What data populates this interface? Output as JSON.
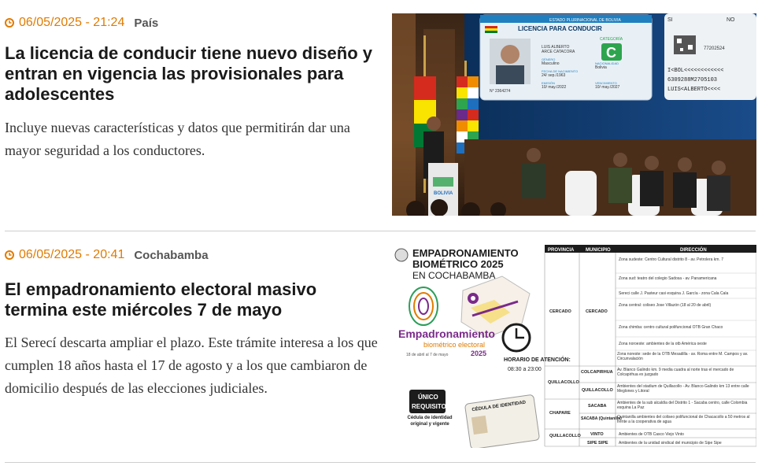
{
  "articles": [
    {
      "date": "06/05/2025 - 21:24",
      "section": "País",
      "title": "La licencia de conducir tiene nuevo diseño y entran en vigencia las provisionales para adolescentes",
      "summary": "Incluye nuevas características y datos que permitirán dar una mayor seguridad a los conductores.",
      "image": {
        "card_header": "ESTADO PLURINACIONAL DE BOLIVIA",
        "card_title": "LICENCIA PARA CONDUCIR",
        "card_category_label": "CATEGORÍA",
        "card_category": "C",
        "card_name": "LUIS ALBERTO",
        "card_surname": "ARCE CATACORA",
        "card_gender_label": "GÉNERO",
        "card_gender": "Masculino",
        "card_nationality_label": "NACIONALIDAD",
        "card_nationality": "Bolivia",
        "card_birth_label": "FECHA DE NACIMIENTO",
        "card_birth": "24/ sep./1963",
        "card_issue_label": "EMISIÓN",
        "card_issue": "10/ may./2022",
        "card_expiry_label": "VENCIMIENTO",
        "card_expiry": "10/ may./2027",
        "card_number": "N° 2364274",
        "back_si": "SI",
        "back_no": "NO",
        "back_mrz1": "I<BOL<<<<<<<<<<<<",
        "back_mrz2": "6309288M2705103",
        "back_mrz3": "LUIS<ALBERTO<<<<",
        "back_code": "77202524",
        "podium_label": "BOLIVIA"
      }
    },
    {
      "date": "06/05/2025 - 20:41",
      "section": "Cochabamba",
      "title": "El empadronamiento electoral masivo termina este miércoles 7 de mayo",
      "summary": "El Serecí descarta ampliar el plazo. Este trámite interesa a los que cumplen 18 años hasta el 17 de agosto y a los que cambiaron de domicilio después de las elecciones judiciales.",
      "image": {
        "heading1": "EMPADRONAMIENTO",
        "heading2": "BIOMÉTRICO 2025",
        "heading3": "EN COCHABAMBA",
        "logo_main": "Empadronamiento",
        "logo_sub": "biométrico electoral",
        "logo_year": "2025",
        "logo_dates": "18 de abril al 7 de mayo",
        "horario_label": "HORARIO DE ATENCIÓN:",
        "horario": "08:30 a 23:00",
        "requisito1": "ÚNICO",
        "requisito2": "REQUISITO",
        "requisito3": "Cédula de identidad original y vigente",
        "cedula_label": "CÉDULA DE IDENTIDAD",
        "table_headers": [
          "PROVINCIA",
          "MUNICIPIO",
          "DIRECCIÓN"
        ],
        "table_rows": [
          {
            "prov": "CERCADO",
            "mun": "CERCADO",
            "dir": [
              "Zona sudeste: Centro Cultural distrito 8 - av. Petrolera km. 7",
              "Zona sud: teatro del colegio Sadosa - av. Panamericana",
              "Sereci calle J. Pasteur casi esquina J. García - zona Cala Cala",
              "Zona central: coliseo Jose Villazón (18 al 20 de abril)",
              "Zona chimba: centro cultural polifuncional OTB Gran Chaco",
              "Zona noroeste: ambientes de la otb América oeste",
              "Zona noreste: sede de la OTB Mesadilla - av. Roma entre M. Campos y av. Circunvalación"
            ]
          },
          {
            "prov": "QUILLACOLLO",
            "mun": "COLCAPIRHUA",
            "dir": [
              "Av. Blanco Galindo km. 9 media cuadra al norte tras el mercado de Colcapirhua ex juzgado"
            ]
          },
          {
            "prov": "QUILLACOLLO",
            "mun": "QUILLACOLLO",
            "dir": [
              "Ambientes del stadium de Quillacollo - Av. Blanco Galindo km 13 entre calle Meglones y Litoral"
            ]
          },
          {
            "prov": "CHAPARE",
            "mun": "SACABA",
            "dir": [
              "Ambientes de la sub alcaldía del Distrito 1 - Sacaba centro, calle Colombia esquina La Paz"
            ]
          },
          {
            "prov": "CHAPARE",
            "mun": "SACABA (Quintanilla)",
            "dir": [
              "Quintanilla ambientes del coliseo polifuncional de Chacacollo a 50 metros al frente a la cooperativa de agua"
            ]
          },
          {
            "prov": "QUILLACOLLO",
            "mun": "VINTO",
            "dir": [
              "Ambientes de OTB Casco Viejo Vinto"
            ]
          },
          {
            "prov": "QUILLACOLLO",
            "mun": "SIPE SIPE",
            "dir": [
              "Ambientes de la unidad sindical del municipio de Sipe Sipe"
            ]
          }
        ]
      }
    }
  ],
  "colors": {
    "date": "#e07b00",
    "divider": "#cfcfcf",
    "title": "#1a1a1a"
  },
  "icons": {
    "date_icon": "clock-icon"
  }
}
